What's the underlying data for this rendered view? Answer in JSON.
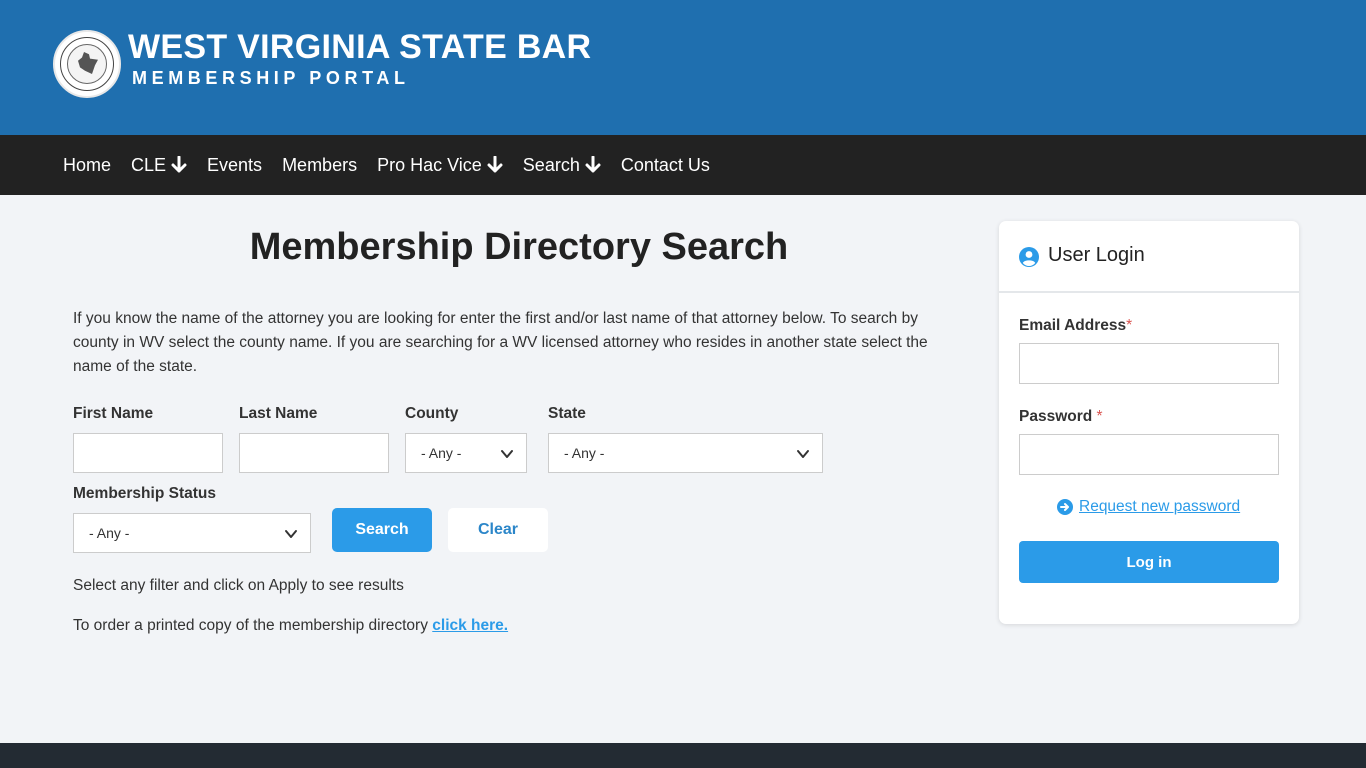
{
  "header": {
    "title": "WEST VIRGINIA STATE BAR",
    "subtitle": "MEMBERSHIP PORTAL",
    "logo_icon": "state-bar-seal-icon"
  },
  "nav": {
    "items": [
      {
        "label": "Home",
        "dropdown": false
      },
      {
        "label": "CLE",
        "dropdown": true
      },
      {
        "label": "Events",
        "dropdown": false
      },
      {
        "label": "Members",
        "dropdown": false
      },
      {
        "label": "Pro Hac Vice",
        "dropdown": true
      },
      {
        "label": "Search",
        "dropdown": true
      },
      {
        "label": "Contact Us",
        "dropdown": false
      }
    ],
    "dropdown_icon": "arrow-down-icon"
  },
  "main": {
    "title": "Membership Directory Search",
    "intro": "If you know the name of the attorney you are looking for enter the first and/or last name of that attorney below. To search by county in WV select the county name. If you are searching for a WV licensed attorney who resides in another state select the name of the state.",
    "filters": {
      "first_name_label": "First Name",
      "first_name_value": "",
      "last_name_label": "Last Name",
      "last_name_value": "",
      "county_label": "County",
      "county_value": "- Any -",
      "state_label": "State",
      "state_value": "- Any -",
      "status_label": "Membership Status",
      "status_value": "- Any -"
    },
    "search_button": "Search",
    "clear_button": "Clear",
    "hint": "Select any filter and click on Apply to see results",
    "order_text": "To order a printed copy of the membership directory ",
    "order_link": "click here."
  },
  "login": {
    "title": "User Login",
    "email_label": "Email Address",
    "password_label": "Password ",
    "required_mark": "*",
    "reset_link": "Request new password",
    "login_button": "Log in"
  },
  "colors": {
    "header_bg": "#1f6faf",
    "nav_bg": "#222222",
    "accent": "#2b9be8",
    "page_bg": "#f2f4f7",
    "footer_bg": "#232b33"
  }
}
